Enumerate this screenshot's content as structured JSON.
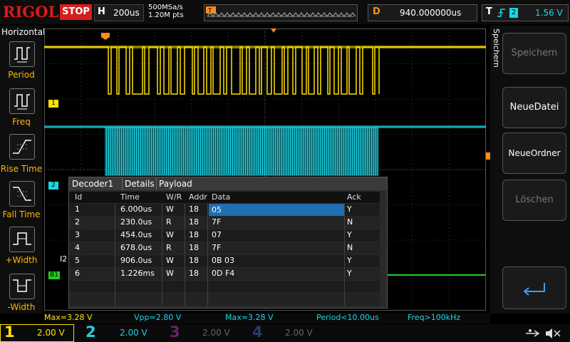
{
  "brand": "RIGOL",
  "run_state": "STOP",
  "timebase": {
    "label": "H",
    "value": "200us"
  },
  "sample": {
    "rate": "500MSa/s",
    "points": "1.20M pts"
  },
  "delay": {
    "label": "D",
    "value": "940.000000us"
  },
  "trigger": {
    "label": "T",
    "source": "2",
    "level": "1.56 V"
  },
  "left_menu": {
    "title": "Horizontal",
    "items": [
      {
        "label": "Period",
        "icon": "period-icon"
      },
      {
        "label": "Freq",
        "icon": "freq-icon"
      },
      {
        "label": "Rise Time",
        "icon": "rise-time-icon"
      },
      {
        "label": "Fall Time",
        "icon": "fall-time-icon"
      },
      {
        "label": "+Width",
        "icon": "pos-width-icon"
      },
      {
        "label": "-Width",
        "icon": "neg-width-icon"
      }
    ]
  },
  "right_menu": {
    "title": "Speichern",
    "items": [
      {
        "label": "Speichern",
        "enabled": false
      },
      {
        "label": "NeueDatei",
        "enabled": true
      },
      {
        "label": "NeueOrdner",
        "enabled": true
      },
      {
        "label": "Löschen",
        "enabled": false
      },
      {
        "label": "enter",
        "icon": "enter-arrow-icon",
        "enabled": true
      }
    ]
  },
  "markers": {
    "ch1": "1",
    "ch2": "2",
    "bus": "B1",
    "i2c_label": "I2"
  },
  "decoder": {
    "tabs": [
      "Decoder1",
      "Details",
      "Payload"
    ],
    "columns": [
      "Id",
      "Time",
      "W/R",
      "Addr",
      "Data",
      "Ack"
    ],
    "rows": [
      {
        "id": "1",
        "time": "6.000us",
        "wr": "W",
        "addr": "18",
        "data": "05",
        "ack": "Y"
      },
      {
        "id": "2",
        "time": "230.0us",
        "wr": "R",
        "addr": "18",
        "data": "7F",
        "ack": "N"
      },
      {
        "id": "3",
        "time": "454.0us",
        "wr": "W",
        "addr": "18",
        "data": "07",
        "ack": "Y"
      },
      {
        "id": "4",
        "time": "678.0us",
        "wr": "R",
        "addr": "18",
        "data": "7F",
        "ack": "N"
      },
      {
        "id": "5",
        "time": "906.0us",
        "wr": "W",
        "addr": "18",
        "data": "0B 03",
        "ack": "Y"
      },
      {
        "id": "6",
        "time": "1.226ms",
        "wr": "W",
        "addr": "18",
        "data": "0D F4",
        "ack": "Y"
      }
    ]
  },
  "measurements": [
    "Max=3.28 V",
    "Vpp=2.80 V",
    "Max=3.28 V",
    "Period<10.00us",
    "Freq>100kHz"
  ],
  "channels": [
    {
      "num": "1",
      "scale": "2.00 V",
      "color": "#ffe100"
    },
    {
      "num": "2",
      "scale": "2.00 V",
      "color": "#1bd6e6"
    },
    {
      "num": "3",
      "scale": "2.00 V",
      "color": "#d81bd8"
    },
    {
      "num": "4",
      "scale": "2.00 V",
      "color": "#2f6fe0"
    }
  ],
  "colors": {
    "ch1": "#ffe100",
    "ch2": "#1bd6e6",
    "bus": "#20d020",
    "accent": "#ff8c1a",
    "brand": "#e01818"
  }
}
